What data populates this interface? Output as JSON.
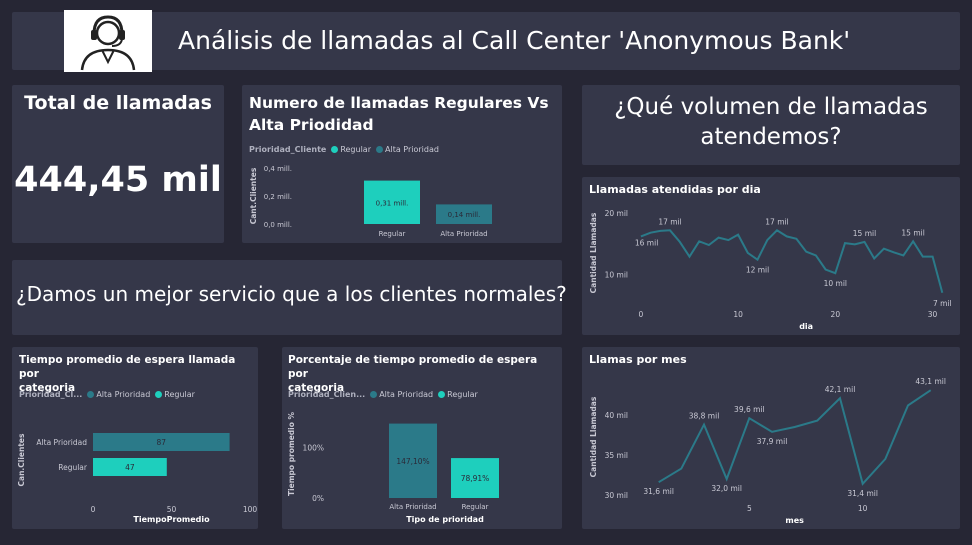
{
  "header": {
    "title": "Análisis de llamadas al Call Center 'Anonymous Bank'",
    "logo_icon": "call-center-agent-icon"
  },
  "kpi": {
    "label": "Total de llamadas",
    "value": "444,45 mil"
  },
  "questions": {
    "service": "¿Damos un mejor servicio que a los clientes normales?",
    "volume_line1": "¿Qué volumen de llamadas",
    "volume_line2": "atendemos?"
  },
  "colors": {
    "regular": "#1ecfbd",
    "alta": "#2b7a89",
    "line": "#2b7a89"
  },
  "chart_data": [
    {
      "id": "calls_by_priority",
      "type": "bar",
      "title": "Numero de llamadas Regulares Vs Alta Priodidad",
      "legend_title": "Prioridad_Cliente",
      "legend": [
        "Regular",
        "Alta Prioridad"
      ],
      "categories": [
        "Regular",
        "Alta Prioridad"
      ],
      "values": [
        0.31,
        0.14
      ],
      "data_labels": [
        "0,31 mill.",
        "0,14 mill."
      ],
      "ylabel": "Cant.Clientes",
      "ylim": [
        0,
        0.4
      ],
      "y_ticks": [
        "0,4 mill.",
        "0,2 mill.",
        "0,0 mill."
      ]
    },
    {
      "id": "calls_per_day",
      "type": "line",
      "title": "Llamadas atendidas por dia",
      "xlabel": "dia",
      "ylabel": "Cantidad Llamadas",
      "x": [
        0,
        1,
        2,
        3,
        4,
        5,
        6,
        7,
        8,
        9,
        10,
        11,
        12,
        13,
        14,
        15,
        16,
        17,
        18,
        19,
        20,
        21,
        22,
        23,
        24,
        25,
        26,
        27,
        28,
        29,
        30,
        31
      ],
      "values": [
        16.2,
        16.8,
        17.1,
        17.2,
        15.3,
        12.9,
        15.4,
        14.8,
        16.0,
        15.6,
        16.5,
        13.5,
        12.4,
        15.6,
        17.2,
        16.2,
        15.8,
        13.7,
        13.1,
        10.8,
        10.2,
        15.1,
        14.9,
        15.3,
        12.6,
        14.2,
        13.6,
        13.1,
        15.4,
        12.9,
        12.9,
        7.0
      ],
      "point_labels": [
        {
          "x": 1,
          "text": "16 mil"
        },
        {
          "x": 3,
          "text": "17 mil"
        },
        {
          "x": 12,
          "text": "12 mil"
        },
        {
          "x": 14,
          "text": "17 mil"
        },
        {
          "x": 20,
          "text": "10 mil"
        },
        {
          "x": 23,
          "text": "15 mil"
        },
        {
          "x": 28,
          "text": "15 mil"
        },
        {
          "x": 31,
          "text": "7 mil"
        }
      ],
      "y_ticks": [
        "20 mil",
        "10 mil"
      ],
      "y_tick_values": [
        20,
        10
      ],
      "x_ticks": [
        "0",
        "10",
        "20",
        "30"
      ],
      "ylim": [
        5,
        21
      ],
      "xlim": [
        -0.5,
        32
      ]
    },
    {
      "id": "wait_time_by_category",
      "type": "bar",
      "orientation": "horizontal",
      "title_line1": "Tiempo promedio de espera llamada por",
      "title_line2": "categoria",
      "legend_title": "Prioridad_Cl...",
      "legend": [
        "Alta Prioridad",
        "Regular"
      ],
      "categories": [
        "Alta Prioridad",
        "Regular"
      ],
      "values": [
        87,
        47
      ],
      "data_labels": [
        "87",
        "47"
      ],
      "xlabel": "TiempoPromedio",
      "ylabel": "Can.Clientes",
      "xlim": [
        0,
        100
      ],
      "x_ticks": [
        "0",
        "50",
        "100"
      ]
    },
    {
      "id": "wait_time_pct",
      "type": "bar",
      "title_line1": "Porcentaje de tiempo promedio de espera por",
      "title_line2": "categoria",
      "legend_title": "Prioridad_Clien...",
      "legend": [
        "Alta Prioridad",
        "Regular"
      ],
      "categories": [
        "Alta Prioridad",
        "Regular"
      ],
      "values": [
        147.1,
        78.91
      ],
      "data_labels": [
        "147,10%",
        "78,91%"
      ],
      "xlabel": "Tipo de prioridad",
      "ylabel": "Tiempo promedio %",
      "ylim": [
        0,
        170
      ],
      "y_ticks": [
        "100%",
        "0%"
      ]
    },
    {
      "id": "calls_per_month",
      "type": "line",
      "title": "Llamas por mes",
      "xlabel": "mes",
      "ylabel": "Cantidad Llamadas",
      "x": [
        1,
        2,
        3,
        4,
        5,
        6,
        7,
        8,
        9,
        10,
        11,
        12
      ],
      "values": [
        31.6,
        33.3,
        38.8,
        32.0,
        39.6,
        37.9,
        38.5,
        39.3,
        42.1,
        31.4,
        34.5,
        41.2,
        43.1
      ],
      "point_labels": [
        {
          "x": 1,
          "text": "31,6 mil"
        },
        {
          "x": 3,
          "text": "38,8 mil"
        },
        {
          "x": 4,
          "text": "32,0 mil"
        },
        {
          "x": 5,
          "text": "39,6 mil"
        },
        {
          "x": 6,
          "text": "37,9 mil"
        },
        {
          "x": 9,
          "text": "42,1 mil"
        },
        {
          "x": 10,
          "text": "31,4 mil"
        },
        {
          "x": 13,
          "text": "43,1 mil"
        }
      ],
      "y_ticks": [
        "40 mil",
        "35 mil",
        "30 mil"
      ],
      "y_tick_values": [
        40,
        35,
        30
      ],
      "x_ticks": [
        "5",
        "10"
      ],
      "ylim": [
        29.5,
        45
      ],
      "xlim": [
        0,
        13.5
      ]
    }
  ]
}
